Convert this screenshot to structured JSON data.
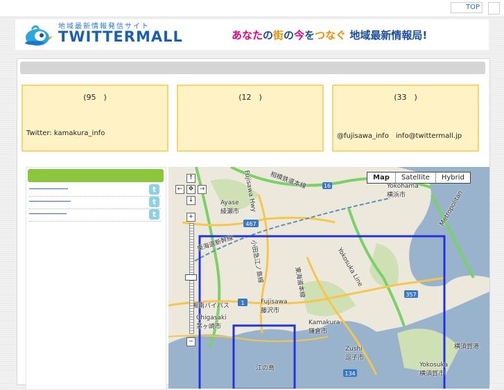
{
  "nav": {
    "top_label": "TOP"
  },
  "banner": {
    "small_text": "地域最新情報発信サイト",
    "logo_text": "TWITTERMALL",
    "tagline_parts": [
      "あなた",
      "の",
      "街",
      "の",
      "今",
      "を",
      "つなぐ",
      "地域最新情報局!"
    ]
  },
  "cards": [
    {
      "count": "(95　)",
      "info": "Twitter: kamakura_info"
    },
    {
      "count": "(12　)",
      "info": ""
    },
    {
      "count": "(33　)",
      "info": "@fujisawa_info　info@twittermall.jp"
    }
  ],
  "sidebar": {
    "items_count": 3,
    "twitter_icon": "twitter-icon"
  },
  "map": {
    "types": [
      "Map",
      "Satellite",
      "Hybrid"
    ],
    "selected_type": "Map",
    "labels": {
      "ayase": "Ayase\n綾瀬市",
      "yokohama": "Yokohama\n横浜市",
      "fujisawa": "Fujisawa\n藤沢市",
      "chigasaki": "Chigasaki\n茅ヶ崎市",
      "kamakura": "Kamakura\n鎌倉市",
      "zushi": "Zushi\n逗子市",
      "yokosuka": "Yokosuka\n横須賀市",
      "yokosuka_port": "横須賀港",
      "enoshima": "江の島",
      "sotetsu": "相模鉄道本線",
      "shinkansen": "東海道新幹線",
      "odakyu": "小田急江ノ島線",
      "tokaido": "東海道本線",
      "bypass": "湘南バイパス",
      "fujisawa_hwy": "Fujisawa Hwy",
      "yokosuka_line": "Yokosuka Line",
      "metropolitan": "Metropolitan"
    },
    "route_badges": [
      "16",
      "467",
      "1",
      "357",
      "134"
    ]
  },
  "colors": {
    "green": "#8cc63f",
    "card_bg": "#fff3c6",
    "card_border": "#f6d66a",
    "map_rect": "#2233dd"
  }
}
